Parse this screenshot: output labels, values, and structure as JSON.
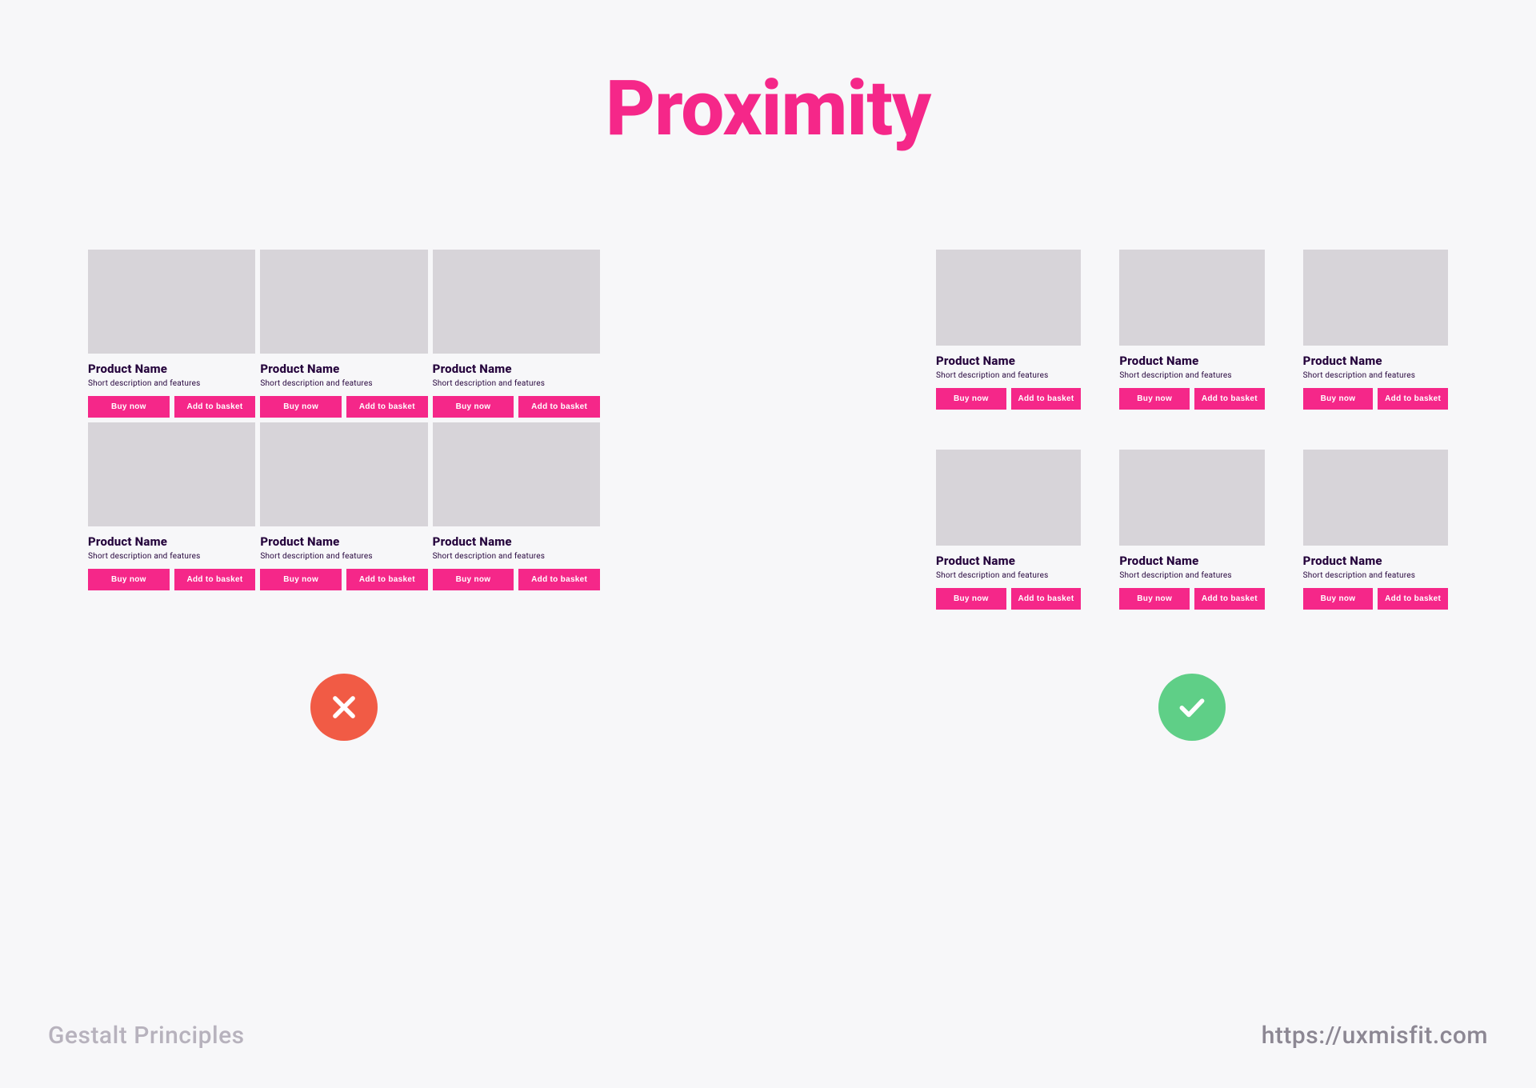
{
  "title": "Proximity",
  "colors": {
    "title": "#f52789",
    "button": "#f52789",
    "bad_badge": "#f15b45",
    "good_badge": "#5fcf87",
    "text_dark": "#26053d"
  },
  "card": {
    "name": "Product Name",
    "desc": "Short description and features",
    "buy": "Buy now",
    "add": "Add to basket"
  },
  "footer": {
    "left": "Gestalt Principles",
    "right": "https://uxmisfit.com"
  }
}
